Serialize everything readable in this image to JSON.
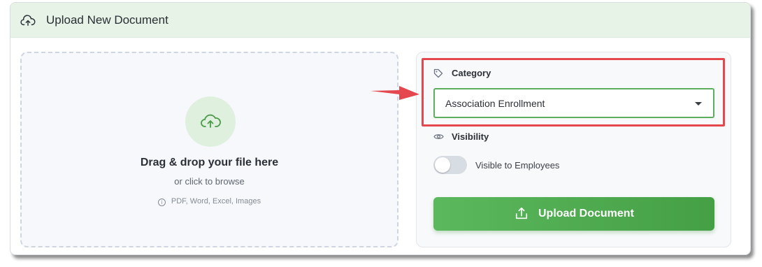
{
  "header": {
    "title": "Upload New Document",
    "icon": "cloud-upload-icon"
  },
  "dropzone": {
    "icon": "cloud-upload-icon",
    "title": "Drag & drop your file here",
    "subtitle": "or click to browse",
    "info_icon": "info-icon",
    "accepted_types": "PDF, Word, Excel, Images"
  },
  "category": {
    "label": "Category",
    "icon": "tag-icon",
    "selected": "Association Enrollment"
  },
  "visibility": {
    "label": "Visibility",
    "icon": "eye-icon",
    "toggle_label": "Visible to Employees",
    "toggle_on": false
  },
  "upload_button": {
    "label": "Upload Document",
    "icon": "upload-tray-icon"
  },
  "colors": {
    "accent_green": "#5cb85c",
    "header_bg": "#e6f3e6",
    "highlight_red": "#e5474f"
  }
}
